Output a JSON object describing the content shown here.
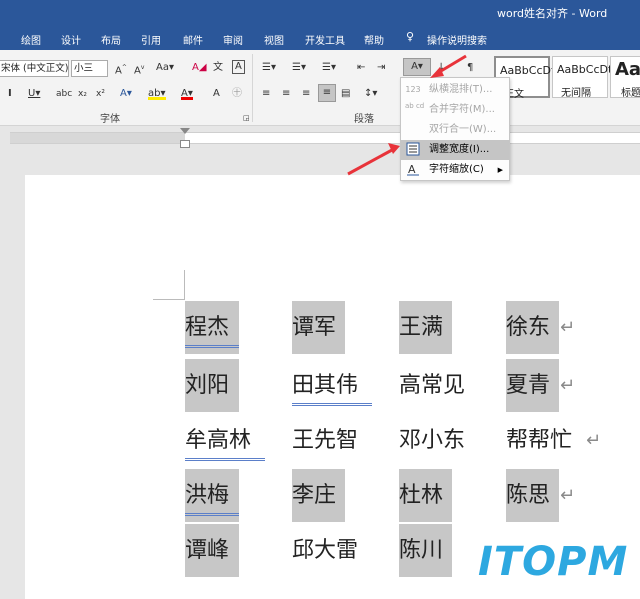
{
  "window": {
    "title": "word姓名对齐 - Word"
  },
  "tabs": [
    "绘图",
    "设计",
    "布局",
    "引用",
    "邮件",
    "审阅",
    "视图",
    "开发工具",
    "帮助"
  ],
  "tell_me": "操作说明搜索",
  "font": {
    "name": "宋体 (中文正文)",
    "size": "小三",
    "group_label": "字体"
  },
  "paragraph": {
    "group_label": "段落"
  },
  "styles": [
    {
      "preview": "AaBbCcDt",
      "name": "正文"
    },
    {
      "preview": "AaBbCcDt",
      "name": "无间隔"
    },
    {
      "preview": "Aa",
      "name": "标题"
    }
  ],
  "dropdown": {
    "items": [
      {
        "icon": "123",
        "label": "纵横混排(T)...",
        "disabled": true
      },
      {
        "icon": "ab cd",
        "label": "合并字符(M)...",
        "disabled": true
      },
      {
        "icon": "",
        "label": "双行合一(W)...",
        "disabled": true
      },
      {
        "icon": "adjust-width-icon",
        "label": "调整宽度(I)...",
        "disabled": false,
        "highlighted": true
      },
      {
        "icon": "character-scaling-icon",
        "label": "字符缩放(C)",
        "disabled": false,
        "has_submenu": true
      }
    ]
  },
  "document": {
    "rows": [
      [
        "程杰",
        "谭军",
        "王满",
        "徐东"
      ],
      [
        "刘阳",
        "田其伟",
        "高常见",
        "夏青"
      ],
      [
        "牟高林",
        "王先智",
        "邓小东",
        "帮帮忙"
      ],
      [
        "洪梅",
        "李庄",
        "杜林",
        "陈思"
      ],
      [
        "谭峰",
        "邱大雷",
        "陈川",
        ""
      ]
    ],
    "paragraph_mark": "↵"
  },
  "watermark": "ITOPM",
  "colors": {
    "accent": "#2b579a",
    "selection_gray": "#c7c7c7",
    "arrow_red": "#e8333a",
    "watermark_blue": "#2da8e0"
  }
}
